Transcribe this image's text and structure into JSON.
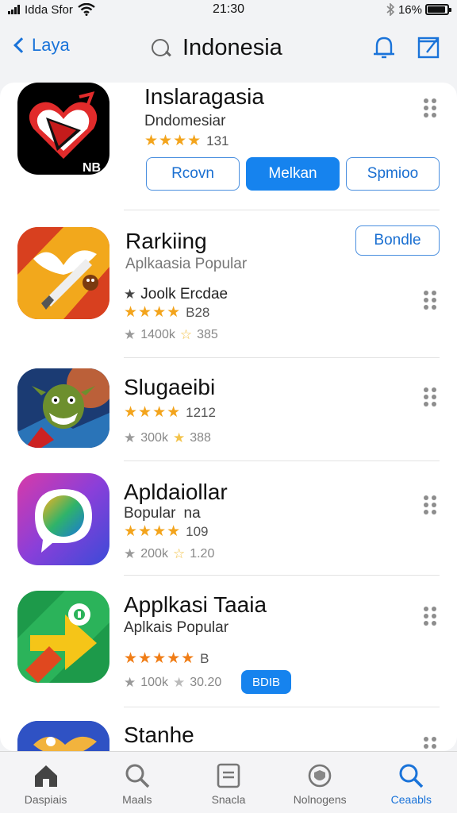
{
  "status": {
    "carrier": "Idda Sfor",
    "time": "21:30",
    "battery": "16%",
    "battery_level": 0.9
  },
  "nav": {
    "back_label": "Laya",
    "title": "Indonesia",
    "icons": [
      "bell-icon",
      "edit-icon",
      "search-icon"
    ]
  },
  "apps": [
    {
      "name": "Inslaragasia",
      "subtitle": "Dndomesiar",
      "stars": "★★★★",
      "rating_count": "131",
      "buttons": [
        "Rcovn",
        "Melkan",
        "Spmioo"
      ],
      "icon": "app-icon-heart-logo"
    },
    {
      "name": "Rarkiing",
      "subtitle": "Aplkaasia Popular",
      "extra_label": "Joolk Ercdae",
      "extra_star": "★",
      "stars": "★★★★",
      "rating_count": "B28",
      "stat_a": "1400k",
      "stat_b": "385",
      "button": "Bondle",
      "icon": "app-icon-bird-rocket"
    },
    {
      "name": "Slugaeibi",
      "stars": "★★★★",
      "rating_count": "1212",
      "stat_a": "300k",
      "stat_b": "388",
      "icon": "app-icon-goblin"
    },
    {
      "name": "Apldaiollar",
      "subtitle": "Bopular",
      "subtitle_b": "na",
      "stars": "★★★★",
      "rating_count": "109",
      "stat_a": "200k",
      "stat_b": "1.20",
      "icon": "app-icon-chat-bubble"
    },
    {
      "name": "Applkasi Taaia",
      "subtitle": "Aplkais Popular",
      "stars": "★★★★★",
      "rating_count": "B",
      "stat_a": "100k",
      "stat_b": "30.20",
      "badge": "BDIB",
      "icon": "app-icon-maps-arrow"
    },
    {
      "name": "Stanhe",
      "icon": "app-icon-blue-bird"
    }
  ],
  "tabs": [
    {
      "label": "Daspiais",
      "icon": "home-icon",
      "active": false
    },
    {
      "label": "Maals",
      "icon": "search-icon",
      "active": false
    },
    {
      "label": "Snacla",
      "icon": "list-icon",
      "active": false
    },
    {
      "label": "Nolnogens",
      "icon": "shield-icon",
      "active": false
    },
    {
      "label": "Ceaabls",
      "icon": "search-icon",
      "active": true
    }
  ],
  "colors": {
    "accent": "#1683ee",
    "link": "#1a73d9",
    "star": "#f3a41c"
  }
}
